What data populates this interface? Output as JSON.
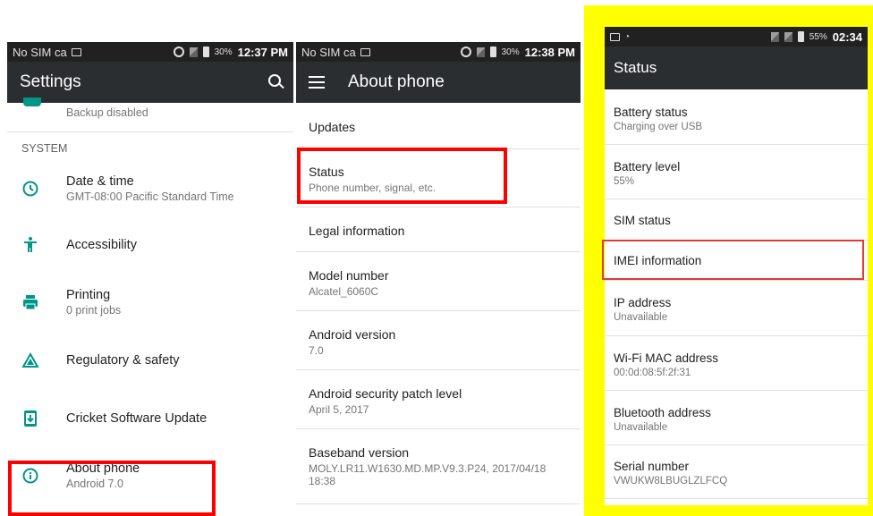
{
  "screens": {
    "settings": {
      "status_bar": {
        "carrier": "No SIM ca",
        "battery": "30%",
        "time": "12:37 PM"
      },
      "title": "Settings",
      "partial_item_subtitle": "Backup disabled",
      "section_header": "SYSTEM",
      "items": [
        {
          "label": "Date & time",
          "subtitle": "GMT-08:00 Pacific Standard Time",
          "icon": "clock-icon"
        },
        {
          "label": "Accessibility",
          "subtitle": "",
          "icon": "accessibility-icon"
        },
        {
          "label": "Printing",
          "subtitle": "0 print jobs",
          "icon": "print-icon"
        },
        {
          "label": "Regulatory & safety",
          "subtitle": "",
          "icon": "regulatory-icon"
        },
        {
          "label": "Cricket Software Update",
          "subtitle": "",
          "icon": "system-update-icon"
        },
        {
          "label": "About phone",
          "subtitle": "Android 7.0",
          "icon": "info-icon"
        }
      ]
    },
    "about_phone": {
      "status_bar": {
        "carrier": "No SIM ca",
        "battery": "30%",
        "time": "12:38 PM"
      },
      "title": "About phone",
      "items": [
        {
          "label": "Updates",
          "subtitle": ""
        },
        {
          "label": "Status",
          "subtitle": "Phone number, signal, etc."
        },
        {
          "label": "Legal information",
          "subtitle": ""
        },
        {
          "label": "Model number",
          "subtitle": "Alcatel_6060C"
        },
        {
          "label": "Android version",
          "subtitle": "7.0"
        },
        {
          "label": "Android security patch level",
          "subtitle": "April 5, 2017"
        },
        {
          "label": "Baseband version",
          "subtitle": "MOLY.LR11.W1630.MD.MP.V9.3.P24, 2017/04/18 18:38"
        }
      ]
    },
    "status": {
      "status_bar": {
        "battery": "55%",
        "time": "02:34"
      },
      "title": "Status",
      "items": [
        {
          "label": "Battery status",
          "subtitle": "Charging over USB"
        },
        {
          "label": "Battery level",
          "subtitle": "55%"
        },
        {
          "label": "SIM status",
          "subtitle": ""
        },
        {
          "label": "IMEI information",
          "subtitle": ""
        },
        {
          "label": "IP address",
          "subtitle": "Unavailable"
        },
        {
          "label": "Wi-Fi MAC address",
          "subtitle": "00:0d:08:5f:2f:31"
        },
        {
          "label": "Bluetooth address",
          "subtitle": "Unavailable"
        },
        {
          "label": "Serial number",
          "subtitle": "VWUKW8LBUGLZLFCQ"
        }
      ]
    }
  },
  "colors": {
    "highlight": "#ff0000",
    "accent": "#009688",
    "appbar": "#2b2e31",
    "yellow_frame": "#ffff00"
  }
}
